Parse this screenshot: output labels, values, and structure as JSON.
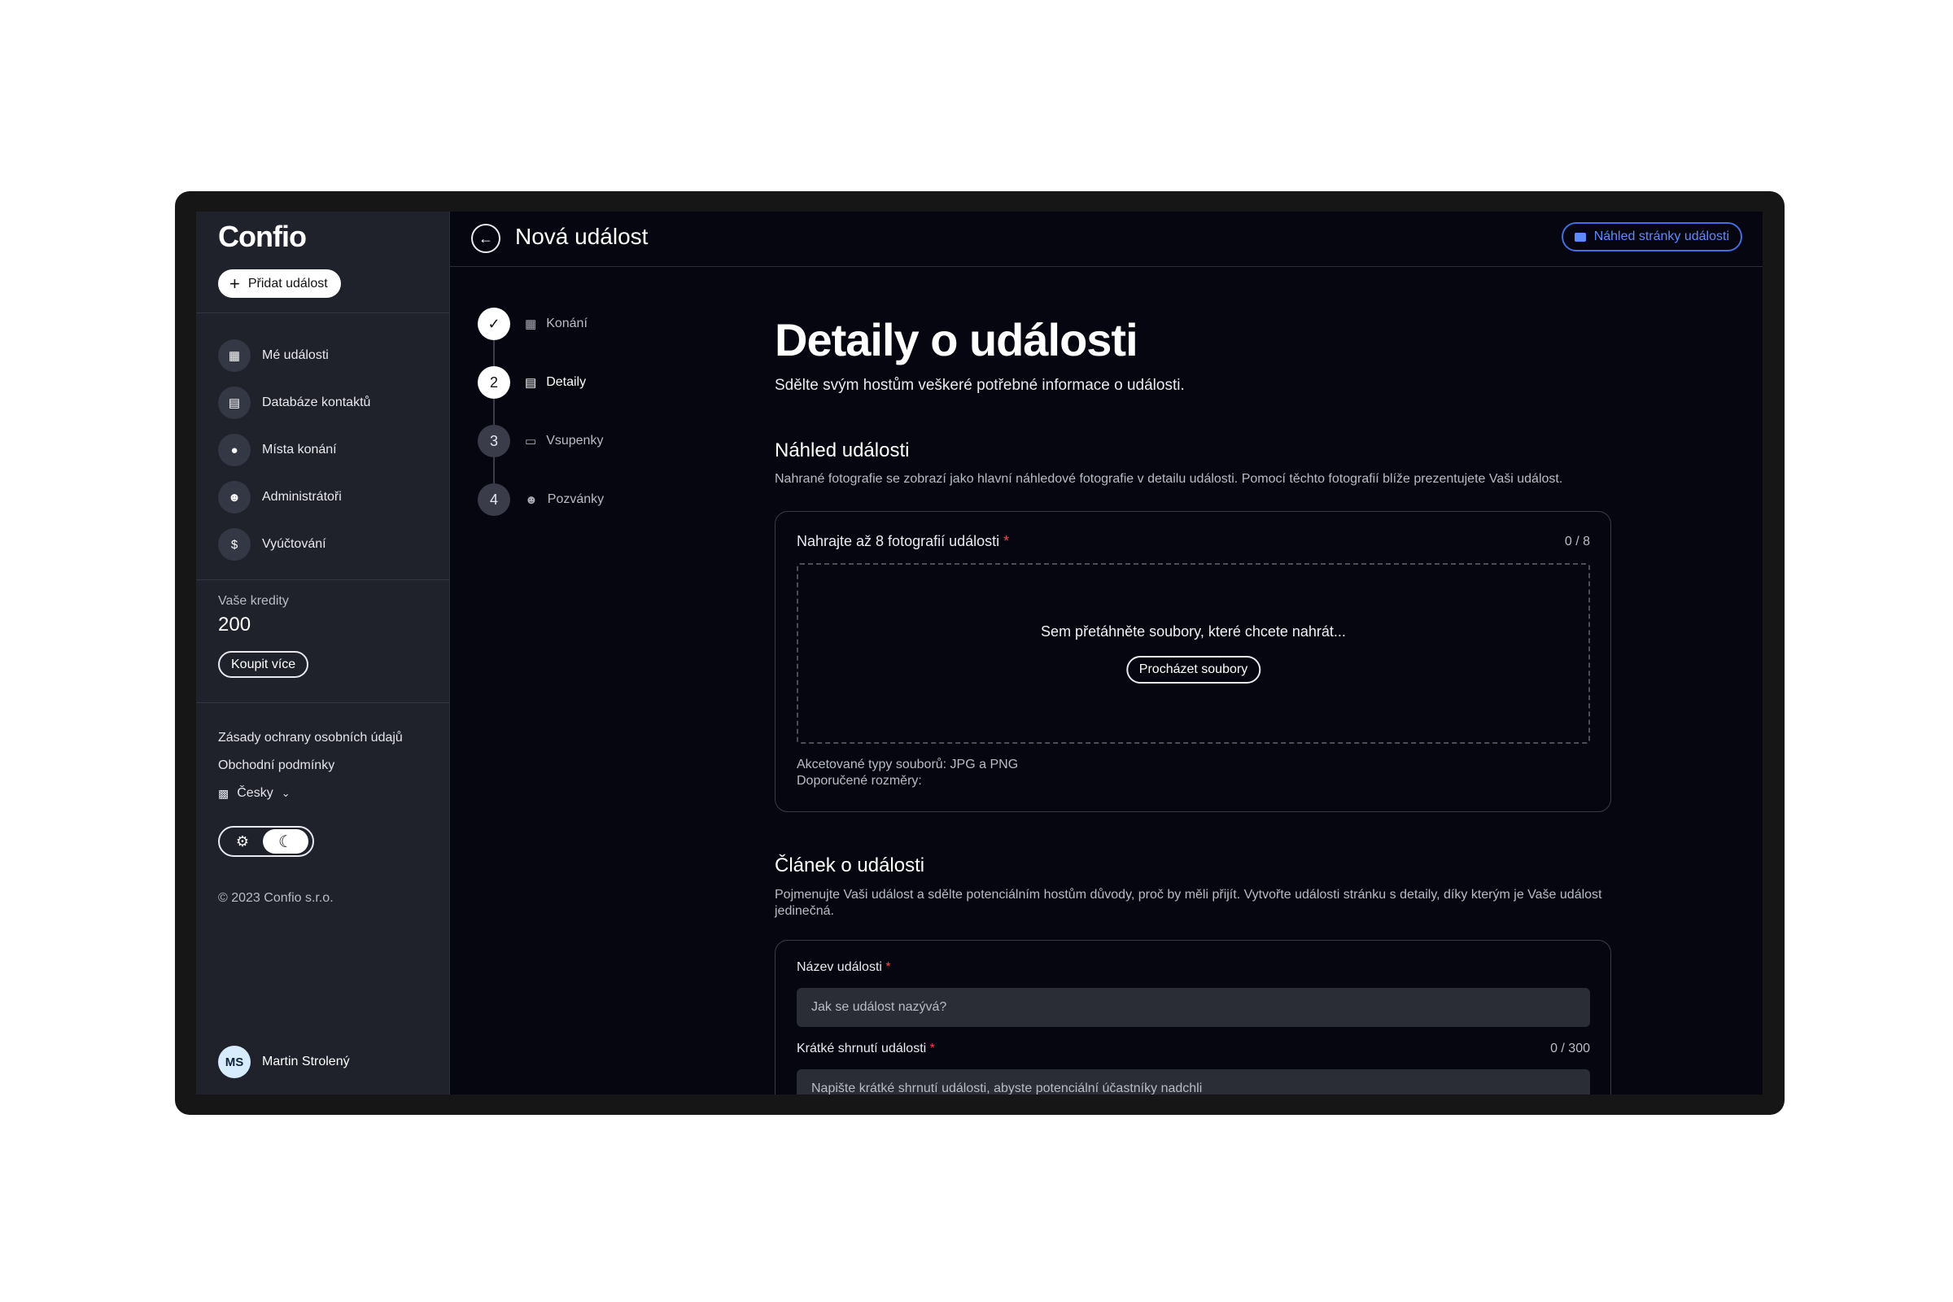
{
  "sidebar": {
    "logo": "Confio",
    "add_event": "Přidat událost",
    "nav": [
      {
        "label": "Mé události",
        "icon": "calendar-icon"
      },
      {
        "label": "Databáze kontaktů",
        "icon": "contacts-icon"
      },
      {
        "label": "Místa konání",
        "icon": "location-pin-icon"
      },
      {
        "label": "Administrátoři",
        "icon": "admin-user-icon"
      },
      {
        "label": "Vyúčtování",
        "icon": "dollar-icon"
      }
    ],
    "credits_label": "Vaše kredity",
    "credits_value": "200",
    "buy_more": "Koupit více",
    "privacy": "Zásady ochrany osobních údajů",
    "terms": "Obchodní podmínky",
    "language": "Česky",
    "copyright": "© 2023 Confio s.r.o.",
    "user_initials": "MS",
    "user_name": "Martin Strolený"
  },
  "topbar": {
    "title": "Nová událost",
    "preview_button": "Náhled stránky události"
  },
  "steps": [
    {
      "number": "",
      "label": "Konání",
      "state": "done",
      "icon": "venue-icon"
    },
    {
      "number": "2",
      "label": "Detaily",
      "state": "active",
      "icon": "document-icon"
    },
    {
      "number": "3",
      "label": "Vsupenky",
      "state": "todo",
      "icon": "ticket-icon"
    },
    {
      "number": "4",
      "label": "Pozvánky",
      "state": "todo",
      "icon": "invite-user-icon"
    }
  ],
  "content": {
    "heading": "Detaily o události",
    "lead": "Sdělte svým hostům veškeré potřebné informace o události.",
    "preview_section": {
      "title": "Náhled události",
      "description": "Nahrané fotografie se zobrazí jako hlavní náhledové fotografie v detailu události. Pomocí těchto fotografií blíže prezentujete Vaši událost.",
      "upload_label": "Nahrajte až 8 fotografií události",
      "upload_counter": "0 / 8",
      "drop_text": "Sem přetáhněte soubory, které chcete nahrát...",
      "browse_button": "Procházet soubory",
      "accepted_types": "Akcetované typy souborů: JPG a PNG",
      "recommended_size": "Doporučené rozměry:"
    },
    "article_section": {
      "title": "Článek o události",
      "description": "Pojmenujte Vaši událost a sdělte potenciálním hostům důvody, proč by měli přijít. Vytvořte události stránku s detaily, díky kterým je Vaše událost jedinečná.",
      "name_label": "Název události",
      "name_placeholder": "Jak se událost nazývá?",
      "summary_label": "Krátké shrnutí události",
      "summary_counter": "0 / 300",
      "summary_placeholder": "Napište krátké shrnutí události, abyste potenciální účastníky nadchli"
    }
  },
  "colors": {
    "background": "#05060f",
    "sidebar": "#1f212b",
    "accent": "#5c8bff",
    "required": "#e64a4a"
  }
}
